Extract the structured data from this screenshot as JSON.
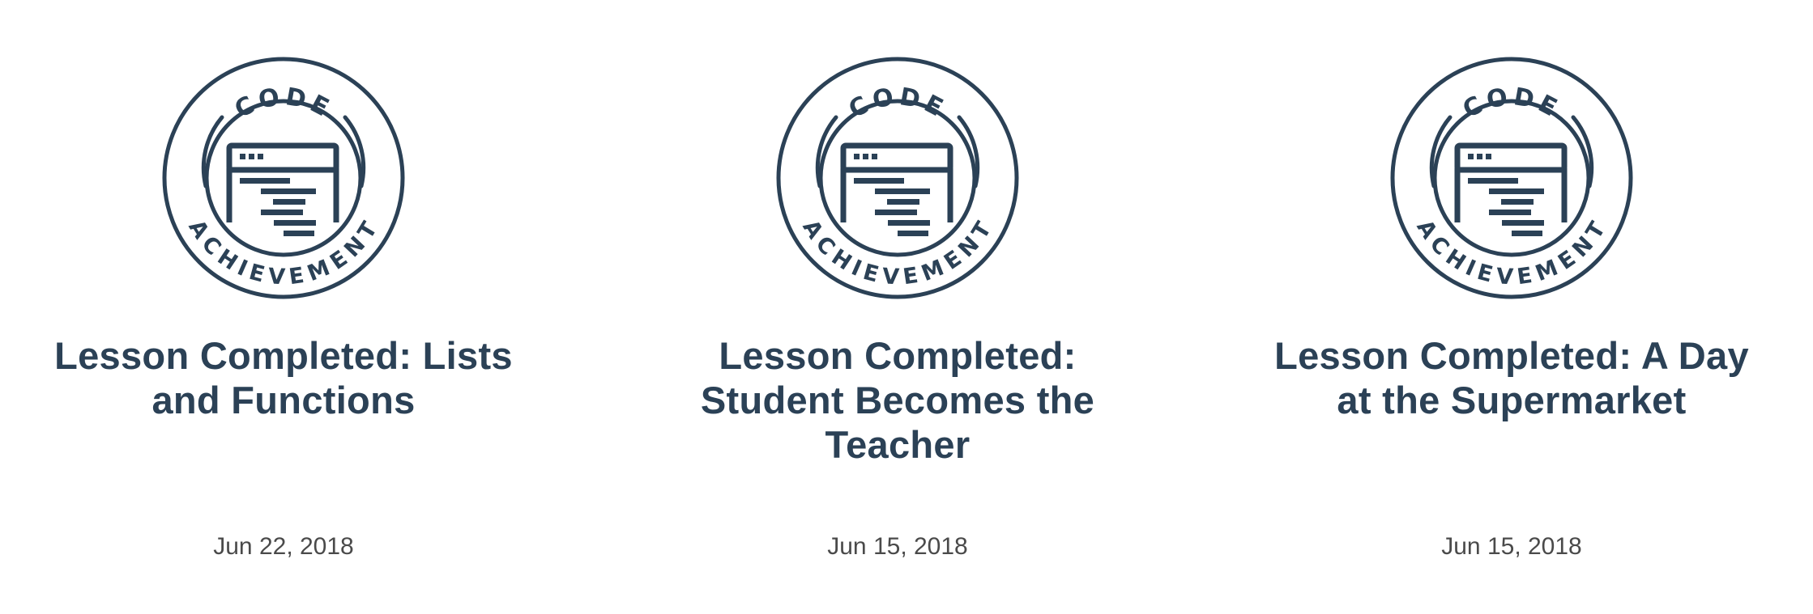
{
  "theme": {
    "badge_color": "#2b4156",
    "title_color": "#2b4156",
    "date_color": "#4a4a4a"
  },
  "achievements": [
    {
      "badge": {
        "icon": "code-window-icon",
        "top_text": "CODE",
        "bottom_text": "ACHIEVEMENT"
      },
      "title": "Lesson Completed: Lists and Functions",
      "date": "Jun 22, 2018"
    },
    {
      "badge": {
        "icon": "code-window-icon",
        "top_text": "CODE",
        "bottom_text": "ACHIEVEMENT"
      },
      "title": "Lesson Completed: Student Becomes the Teacher",
      "date": "Jun 15, 2018"
    },
    {
      "badge": {
        "icon": "code-window-icon",
        "top_text": "CODE",
        "bottom_text": "ACHIEVEMENT"
      },
      "title": "Lesson Completed: A Day at the Supermarket",
      "date": "Jun 15, 2018"
    }
  ]
}
